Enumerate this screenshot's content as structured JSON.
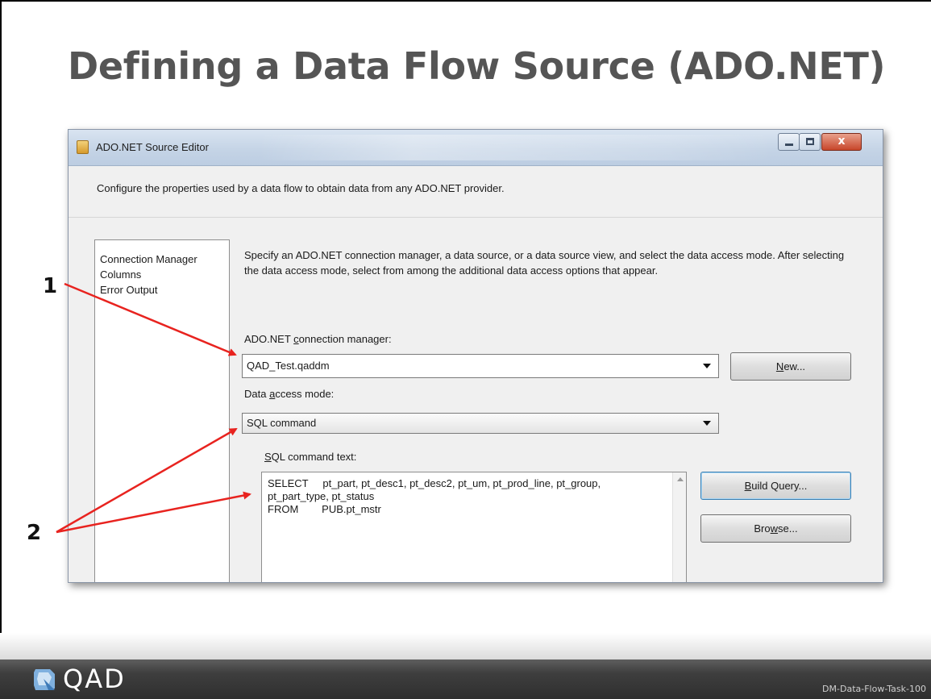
{
  "slide": {
    "title": "Defining a Data Flow Source (ADO.NET)",
    "footer_code": "DM-Data-Flow-Task-100",
    "logo_text": "QAD"
  },
  "window": {
    "title": "ADO.NET Source Editor",
    "close_glyph": "x",
    "description": "Configure the properties used by a data flow to obtain data from any ADO.NET provider.",
    "nav_items": [
      "Connection Manager",
      "Columns",
      "Error Output"
    ],
    "instructions": "Specify an ADO.NET connection manager, a data source, or a data source view, and select the data access mode. After selecting the data access mode, select from among the additional data access options that appear.",
    "connection_manager": {
      "label_pre": "ADO.NET ",
      "label_accel": "c",
      "label_post": "onnection manager:",
      "value": "QAD_Test.qaddm",
      "new_button_accel": "N",
      "new_button_post": "ew..."
    },
    "data_access_mode": {
      "label_pre": "Data ",
      "label_accel": "a",
      "label_post": "ccess mode:",
      "value": "SQL command"
    },
    "sql_command": {
      "label_accel": "S",
      "label_post": "QL command text:",
      "text": "SELECT     pt_part, pt_desc1, pt_desc2, pt_um, pt_prod_line, pt_group,\npt_part_type, pt_status\nFROM        PUB.pt_mstr",
      "build_query_accel": "B",
      "build_query_post": "uild Query...",
      "browse_pre": "Bro",
      "browse_accel": "w",
      "browse_post": "se..."
    }
  },
  "annotations": {
    "label_1": "1",
    "label_2": "2",
    "arrow_color": "#e8231f"
  }
}
